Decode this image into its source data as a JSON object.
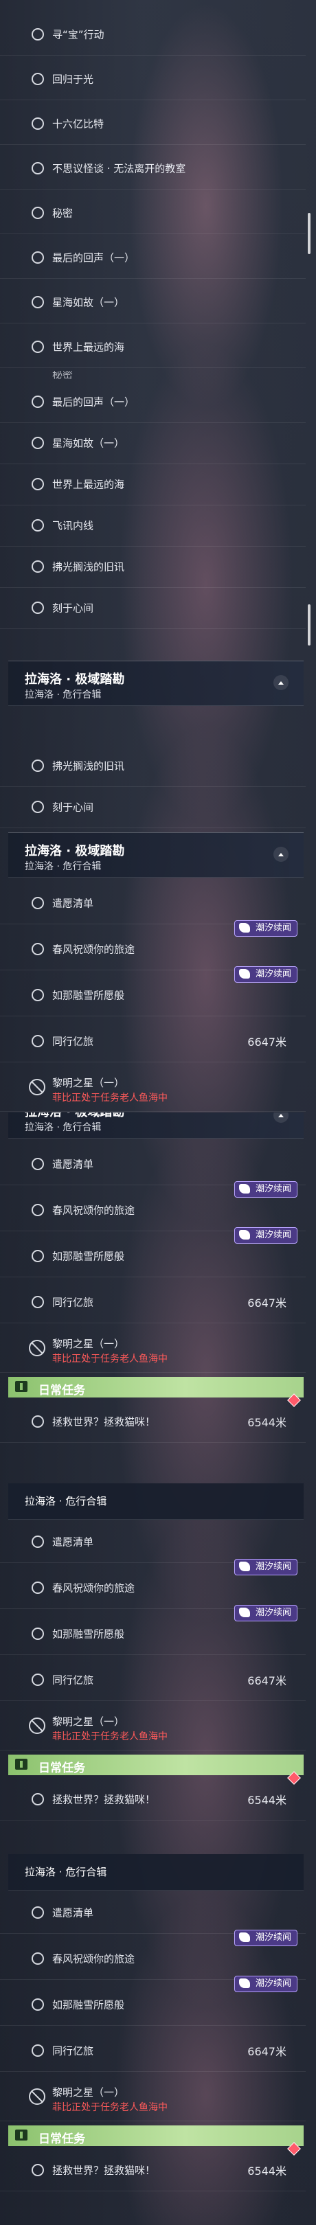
{
  "quests": {
    "xun_bao": "寻“宝”行动",
    "hui_gui": "回归于光",
    "shi_liu_yi": "十六亿比特",
    "bu_si_yi": "不思议怪谈 · 无法离开的教室",
    "mi_mi": "秘密",
    "zui_hou": "最后的回声（一）",
    "xing_hai": "星海如故（一）",
    "shi_jie": "世界上最远的海",
    "fei_xun": "飞讯内线",
    "fu_guang": "拂光搁浅的旧讯",
    "ke_yu": "刻于心间",
    "qian_yuan": "遣愿清单",
    "chun_feng": "春风祝颂你的旅途",
    "ru_na": "如那融雪所愿般",
    "tong_xing": "同行亿旅",
    "li_ming": "黎明之星（一）",
    "zheng_jiu": "拯救世界？拯救猫咪！"
  },
  "ghost_fragment": "秘密",
  "region": {
    "title": "拉海洛 · 极域踏勘",
    "subtitle": "拉海洛 · 危行合辑"
  },
  "badge_label": "潮汐续闻",
  "distances": {
    "tong_xing": "6647米",
    "zheng_jiu": "6544米"
  },
  "li_ming_warning": "菲比正处于任务老人鱼海中",
  "daily_title": "日常任务",
  "colors": {
    "warning": "#ff5a5a",
    "badge_bg": "#4b3a86",
    "daily_green": "#8cc26e"
  }
}
